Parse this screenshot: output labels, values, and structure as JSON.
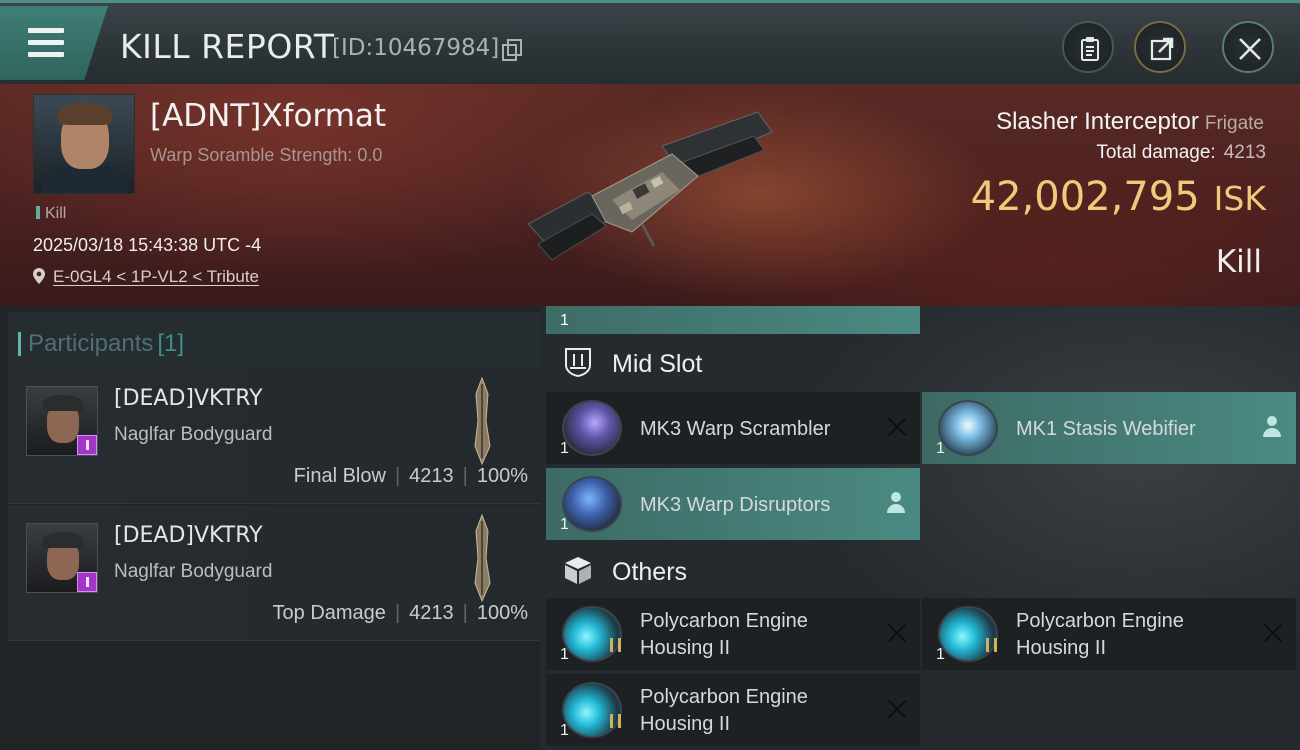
{
  "header": {
    "title": "KILL REPORT",
    "report_id": "[ID:10467984]"
  },
  "victim": {
    "name": "[ADNT]Xformat",
    "warp_scramble": "Warp Soramble Strength: 0.0",
    "kill_tag": "Kill",
    "datetime": "2025/03/18 15:43:38 UTC -4",
    "location": "E-0GL4 < 1P-VL2 < Tribute",
    "ship_name": "Slasher Interceptor",
    "ship_class": "Frigate",
    "total_damage_label": "Total damage:",
    "total_damage": "4213",
    "isk_value": "42,002,795",
    "isk_unit": "ISK",
    "result": "Kill"
  },
  "participants": {
    "title": "Participants",
    "count": "[1]",
    "items": [
      {
        "name": "[DEAD]VKTRY",
        "ship": "Naglfar Bodyguard",
        "role": "Final Blow",
        "damage": "4213",
        "percent": "100%"
      },
      {
        "name": "[DEAD]VKTRY",
        "ship": "Naglfar Bodyguard",
        "role": "Top Damage",
        "damage": "4213",
        "percent": "100%"
      }
    ]
  },
  "fitting": {
    "partial_qty": "1",
    "mid_slot_label": "Mid Slot",
    "others_label": "Others",
    "mid_slot": [
      {
        "qty": "1",
        "name": "MK3 Warp Scrambler",
        "status": "destroyed"
      },
      {
        "qty": "1",
        "name": "MK1 Stasis Webifier",
        "status": "dropped"
      },
      {
        "qty": "1",
        "name": "MK3 Warp Disruptors",
        "status": "dropped"
      }
    ],
    "others": [
      {
        "qty": "1",
        "name": "Polycarbon Engine Housing II",
        "status": "destroyed"
      },
      {
        "qty": "1",
        "name": "Polycarbon Engine Housing II",
        "status": "destroyed"
      },
      {
        "qty": "1",
        "name": "Polycarbon Engine Housing II",
        "status": "destroyed"
      }
    ]
  },
  "colors": {
    "accent": "#4a8a82",
    "isk": "#f2c97a",
    "badge": "#a335c9"
  },
  "icons": [
    "menu-icon",
    "copy-icon",
    "clipboard-icon",
    "share-icon",
    "close-icon",
    "location-pin-icon",
    "mid-slot-icon",
    "others-box-icon",
    "destroyed-x-icon",
    "dropped-person-icon"
  ]
}
